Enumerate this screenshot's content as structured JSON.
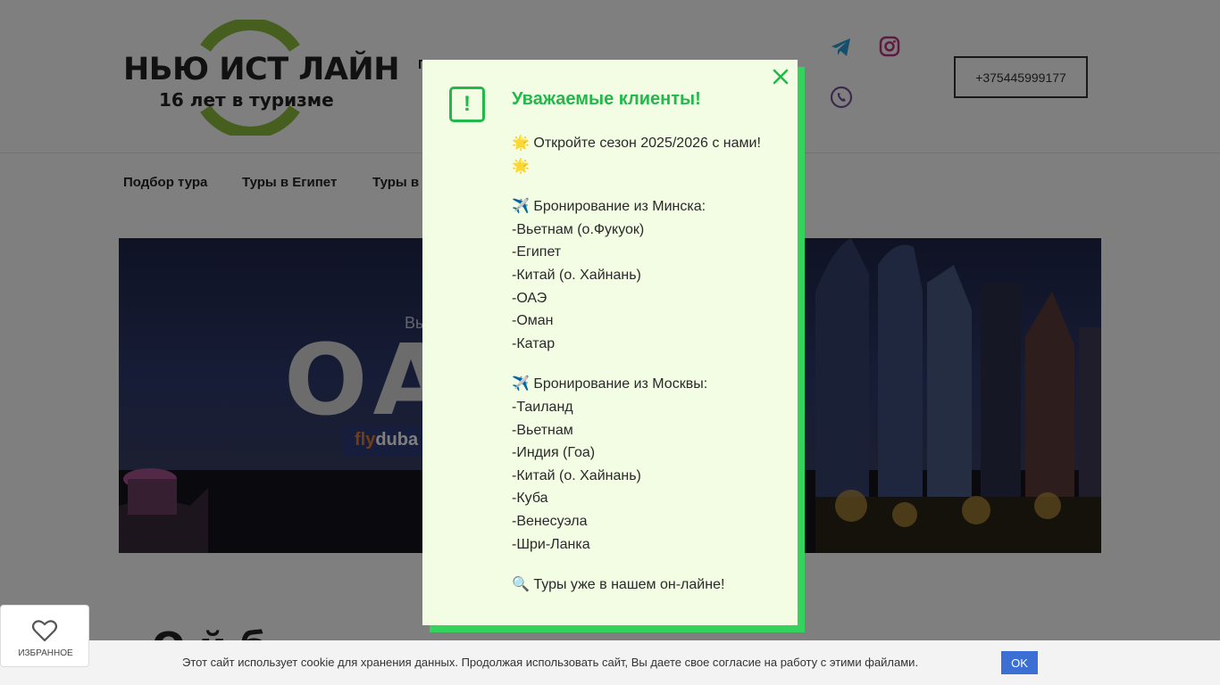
{
  "header": {
    "logo_title": "НЬЮ ИСТ ЛАЙН",
    "logo_subtitle": "16 лет в туризме",
    "hidden_text": "П",
    "phone": "+375445999177",
    "social_icons": [
      "telegram-icon",
      "instagram-icon",
      "viber-icon"
    ]
  },
  "nav": {
    "items": [
      {
        "label": "Подбор тура"
      },
      {
        "label": "Туры в Египет"
      },
      {
        "label": "Туры в"
      }
    ]
  },
  "banner": {
    "pretitle": "Вы",
    "big_text": "ОА",
    "airline_prefix": "fly",
    "airline_suffix": "duba"
  },
  "main": {
    "heading_partial": "О   й  б"
  },
  "modal": {
    "title": "Уважаемые клиенты!",
    "alert_symbol": "!",
    "intro": "🌟 Откройте сезон 2025/2026 с нами! 🌟",
    "minsk_heading": "✈️ Бронирование из Минска:",
    "minsk_items": [
      "-Вьетнам (о.Фукуок)",
      "-Египет",
      "-Китай (о. Хайнань)",
      "-ОАЭ",
      "-Оман",
      "-Катар"
    ],
    "moscow_heading": "✈️ Бронирование из Москвы:",
    "moscow_items": [
      "-Таиланд",
      "-Вьетнам",
      "-Индия (Гоа)",
      "-Китай (о. Хайнань)",
      "-Куба",
      "-Венесуэла",
      "-Шри-Ланка"
    ],
    "footer": "🔍 Туры уже в нашем он-лайне!"
  },
  "cookie": {
    "text": "Этот сайт использует cookie для хранения данных. Продолжая использовать сайт, Вы даете свое согласие на работу с этими файлами.",
    "ok_label": "OK"
  },
  "favorites": {
    "label": "ИЗБРАННОЕ"
  },
  "colors": {
    "accent_green": "#22b84a",
    "modal_bg": "#f2fde4",
    "logo_green": "#8cbf3f",
    "cookie_button": "#3b6fd4"
  }
}
